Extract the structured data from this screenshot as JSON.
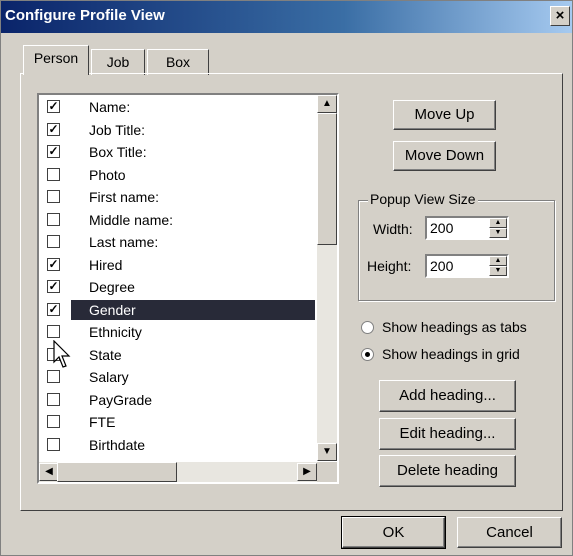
{
  "window": {
    "title": "Configure Profile View",
    "close_label": "×"
  },
  "tabs": [
    {
      "label": "Person"
    },
    {
      "label": "Job"
    },
    {
      "label": "Box"
    }
  ],
  "fields": [
    {
      "label": "Name:",
      "checked": true
    },
    {
      "label": "Job Title:",
      "checked": true
    },
    {
      "label": "Box Title:",
      "checked": true
    },
    {
      "label": "Photo",
      "checked": false
    },
    {
      "label": "First name:",
      "checked": false
    },
    {
      "label": "Middle name:",
      "checked": false
    },
    {
      "label": "Last name:",
      "checked": false
    },
    {
      "label": "Hired",
      "checked": true
    },
    {
      "label": "Degree",
      "checked": true
    },
    {
      "label": "Gender",
      "checked": true,
      "selected": true
    },
    {
      "label": "Ethnicity",
      "checked": false
    },
    {
      "label": "State",
      "checked": false
    },
    {
      "label": "Salary",
      "checked": false
    },
    {
      "label": "PayGrade",
      "checked": false
    },
    {
      "label": "FTE",
      "checked": false
    },
    {
      "label": "Birthdate",
      "checked": false
    }
  ],
  "buttons": {
    "move_up": "Move Up",
    "move_down": "Move Down",
    "add_heading": "Add heading...",
    "edit_heading": "Edit heading...",
    "delete_heading": "Delete heading",
    "ok": "OK",
    "cancel": "Cancel"
  },
  "popup_view_size": {
    "title": "Popup View Size",
    "width_label": "Width:",
    "width_value": "200",
    "height_label": "Height:",
    "height_value": "200"
  },
  "heading_mode": {
    "tabs_label": "Show headings as tabs",
    "grid_label": "Show headings in grid",
    "selected": "grid"
  }
}
